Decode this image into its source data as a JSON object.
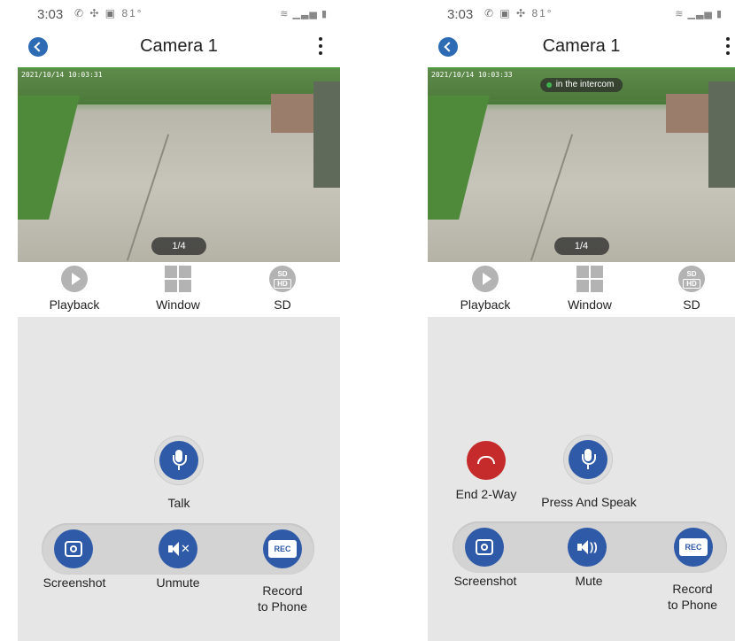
{
  "left": {
    "status": {
      "time": "3:03",
      "temp": "81°"
    },
    "title": "Camera 1",
    "timestamp": "2021/10/14 10:03:31",
    "page_indicator": "1/4",
    "controls": {
      "playback": "Playback",
      "window": "Window",
      "sd": "SD",
      "sd_badge_top": "SD",
      "sd_badge_bottom": "HD"
    },
    "talk_label": "Talk",
    "tray": {
      "screenshot": "Screenshot",
      "audio": "Unmute",
      "record_line1": "Record",
      "record_line2": "to Phone",
      "rec_badge": "REC"
    }
  },
  "right": {
    "status": {
      "time": "3:03",
      "temp": "81°"
    },
    "title": "Camera 1",
    "timestamp": "2021/10/14 10:03:33",
    "intercom": "in the intercom",
    "page_indicator": "1/4",
    "controls": {
      "playback": "Playback",
      "window": "Window",
      "sd": "SD",
      "sd_badge_top": "SD",
      "sd_badge_bottom": "HD"
    },
    "end_label": "End 2-Way",
    "speak_label": "Press And Speak",
    "tray": {
      "screenshot": "Screenshot",
      "audio": "Mute",
      "record_line1": "Record",
      "record_line2": "to Phone",
      "rec_badge": "REC"
    }
  },
  "colors": {
    "accent": "#2f5aa8",
    "end_call": "#c62b2b",
    "video_border": "#4d9a43"
  }
}
